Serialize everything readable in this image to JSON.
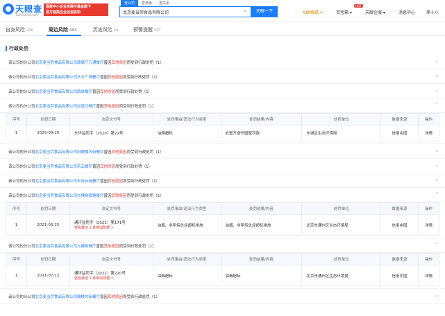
{
  "brand": {
    "name": "天眼查",
    "site": "TianYanCha.com",
    "promo_line1": "国家中小企业发展子基金旗下",
    "promo_line2": "官方备案企业征信机构"
  },
  "search": {
    "tabs": [
      "查公司",
      "查老板",
      "查关系"
    ],
    "value": "北京麦当劳食品有限公司",
    "button": "天眼一下"
  },
  "nav": {
    "vip": "VIP会员 ▾",
    "baibao": "百宝箱 ▾",
    "hot": "HOT",
    "enterprise": "天眼企服 ▾",
    "messages": "消息中心",
    "user": "茅十八"
  },
  "tabs": [
    {
      "label": "自身风险",
      "count": "236"
    },
    {
      "label": "周边风险",
      "count": "493"
    },
    {
      "label": "历史风险",
      "count": "64"
    },
    {
      "label": "预警提醒",
      "count": "427"
    }
  ],
  "section_title": "行政处罚",
  "rows": [
    {
      "pre": "该公司的分公司",
      "link": "北京麦当劳食品有限公司康塬门万通餐厅",
      "mid": "曾因",
      "red": "其他原因",
      "post": "而受到行政处罚（1）",
      "chev": "⌄"
    },
    {
      "pre": "该公司的分公司",
      "link": "北京麦当劳食品有限公司东方广场餐厅",
      "mid": "曾因",
      "red": "其他原因",
      "post": "而受到行政处罚（1）",
      "chev": "⌄"
    },
    {
      "pre": "该公司的分公司",
      "link": "北京麦当劳食品有限公司西单餐厅",
      "mid": "曾因",
      "red": "其他原因",
      "post": "而受到行政处罚（1）",
      "chev": "⌄"
    },
    {
      "pre": "该公司的分公司",
      "link": "北京麦当劳食品有限公司交道口餐厅",
      "mid": "曾因",
      "red": "其他原因",
      "post": "而受到行政处罚（1）",
      "chev": "⌃"
    },
    {
      "pre": "该公司的分公司",
      "link": "北京麦当劳食品有限公司旧鼓楼大街餐厅",
      "mid": "曾因",
      "red": "其他原因",
      "post": "而受到行政处罚（1）",
      "chev": "⌄"
    },
    {
      "pre": "该公司的分公司",
      "link": "北京麦当劳食品有限公司京云餐厅",
      "mid": "曾因",
      "red": "其他原因",
      "post": "而受到行政处罚（1）",
      "chev": "⌄"
    },
    {
      "pre": "该公司的分公司",
      "link": "北京麦当劳食品有限公司丰台云岗餐厅",
      "mid": "曾因",
      "red": "其他原因",
      "post": "而受到行政处罚（1）",
      "chev": "⌄"
    },
    {
      "pre": "该公司的分公司",
      "link": "北京麦当劳食品有限公司九棵树西路餐厅",
      "mid": "曾因",
      "red": "其他原因",
      "post": "而受到行政处罚（1）",
      "chev": "⌃"
    },
    {
      "pre": "该公司的分公司",
      "link": "北京麦当劳食品有限公司九棵树餐厅",
      "mid": "曾因",
      "red": "其他原因",
      "post": "而受到行政处罚（1）",
      "chev": "⌃"
    },
    {
      "pre": "该公司的分公司",
      "link": "北京麦当劳食品有限公司鼓楼大街餐厅",
      "mid": "曾因",
      "red": "其他原因",
      "post": "而受到行政处罚（1）",
      "chev": "⌄"
    }
  ],
  "table_headers": [
    "序号",
    "处罚日期",
    "决定文书号",
    "处罚事由/违法行为类型",
    "处罚结果/内容",
    "处罚单位",
    "数据来源",
    "操作"
  ],
  "tables": [
    {
      "no": "1",
      "date": "2020-08-26",
      "doc": "东环监罚字〔2020〕第22号",
      "more": "",
      "reason": "油烟超标",
      "result": "处壹万叁仟圆整罚款",
      "unit": "东城区生态环境局",
      "source": "信用中国",
      "op": "详情"
    },
    {
      "no": "1",
      "date": "2021-06-25",
      "doc": "通环监罚字〔2021〕第171号",
      "more": "查看其他 1 条相似数据 >",
      "reason": "油烟、非甲烷总烃超标排放",
      "result": "油烟、非甲烷总烃超标排放",
      "unit": "北京市通州区生态环境局",
      "source": "信用中国",
      "op": "详情"
    },
    {
      "no": "1",
      "date": "2021-07-12",
      "doc": "通环监罚字〔2021〕第220号",
      "more": "查看其他 1 条相似数据 >",
      "reason": "油烟超标",
      "result": "油烟超标",
      "unit": "北京市通州区生态环境局",
      "source": "信用中国",
      "op": "详情"
    }
  ],
  "colors": {
    "accent": "#1a7cff",
    "danger": "#e8392f",
    "vip": "#e79e2e"
  }
}
